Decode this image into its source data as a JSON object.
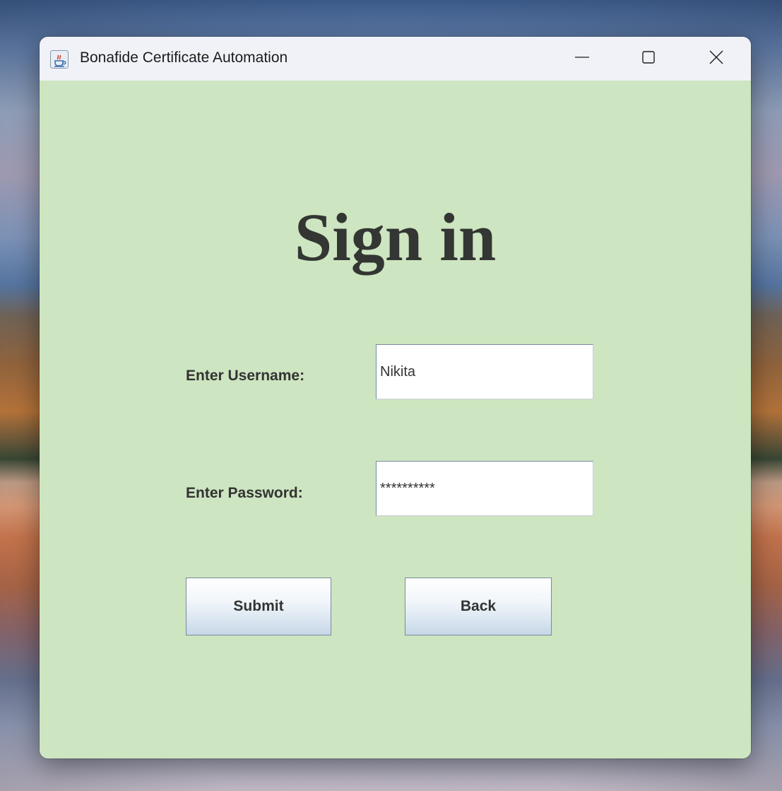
{
  "window": {
    "title": "Bonafide Certificate Automation",
    "icon": "java-cup-icon",
    "controls": {
      "minimize_icon": "minimize-icon",
      "maximize_icon": "maximize-icon",
      "close_icon": "close-icon"
    }
  },
  "form": {
    "heading": "Sign in",
    "username_label": "Enter Username:",
    "username_value": "Nikita",
    "password_label": "Enter Password:",
    "password_value": "**********",
    "submit_label": "Submit",
    "back_label": "Back"
  },
  "colors": {
    "content_background": "#cde5c0",
    "titlebar_background": "#f0f2f8",
    "heading_text": "#333633"
  }
}
